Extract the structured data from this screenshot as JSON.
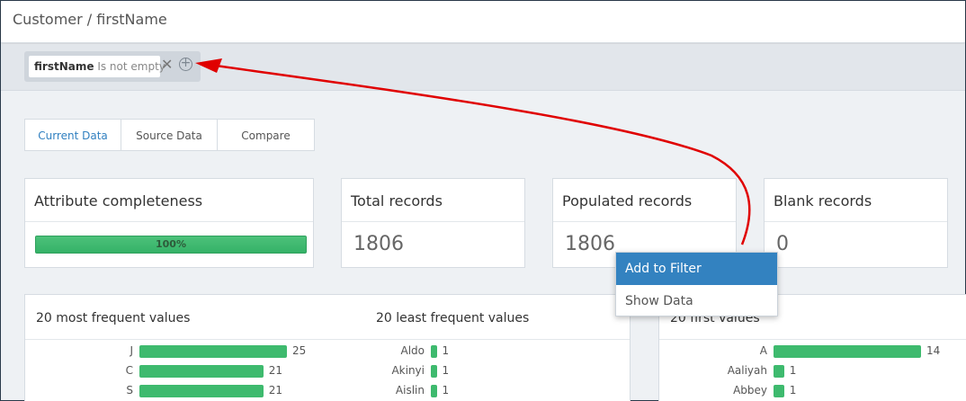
{
  "header": {
    "breadcrumb": "Customer / firstName"
  },
  "filter": {
    "field": "firstName",
    "condition": "Is not empty",
    "remove": "✕",
    "add": "+"
  },
  "tabs": [
    {
      "label": "Current Data",
      "active": true
    },
    {
      "label": "Source Data",
      "active": false
    },
    {
      "label": "Compare",
      "active": false
    }
  ],
  "cards": {
    "completeness": {
      "title": "Attribute completeness",
      "percent_label": "100%",
      "fill_fraction": 1.0
    },
    "total": {
      "title": "Total records",
      "value": "1806"
    },
    "populated": {
      "title": "Populated records",
      "value": "1806"
    },
    "blank": {
      "title": "Blank records",
      "value": "0"
    }
  },
  "most_frequent": {
    "title": "20 most frequent values",
    "rows": [
      {
        "label": "J",
        "count": "25",
        "value": 25
      },
      {
        "label": "C",
        "count": "21",
        "value": 21
      },
      {
        "label": "S",
        "count": "21",
        "value": 21
      }
    ]
  },
  "least_frequent": {
    "title": "20 least frequent values",
    "rows": [
      {
        "label": "Aldo",
        "count": "1",
        "value": 1
      },
      {
        "label": "Akinyi",
        "count": "1",
        "value": 1
      },
      {
        "label": "Aislin",
        "count": "1",
        "value": 1
      }
    ]
  },
  "first_values": {
    "title": "20 first values",
    "rows": [
      {
        "label": "A",
        "count": "14",
        "value": 14
      },
      {
        "label": "Aaliyah",
        "count": "1",
        "value": 1
      },
      {
        "label": "Abbey",
        "count": "1",
        "value": 1
      }
    ]
  },
  "context_menu": {
    "items": [
      "Add to Filter",
      "Show Data"
    ],
    "active_index": 0
  },
  "colors": {
    "accent": "#3382c0",
    "bar": "#3eba6e",
    "arrow": "#e00000"
  }
}
